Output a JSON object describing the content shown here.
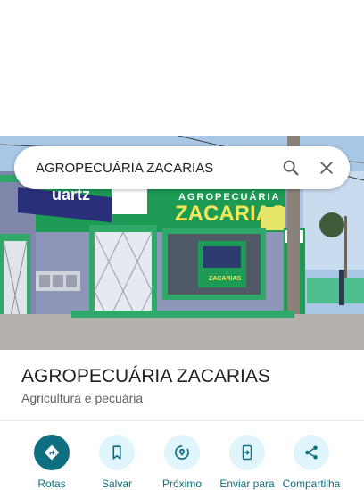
{
  "search": {
    "value": "AGROPECUÁRIA ZACARIAS"
  },
  "place": {
    "name": "AGROPECUÁRIA ZACARIAS",
    "category": "Agricultura e pecuária"
  },
  "photo": {
    "sign_name": "AGROPECUÁRIA",
    "sign_brand": "ZACARIAS",
    "sign_partial": "uartz"
  },
  "actions": [
    {
      "label": "Rotas",
      "icon": "directions-icon"
    },
    {
      "label": "Salvar",
      "icon": "bookmark-icon"
    },
    {
      "label": "Próximo",
      "icon": "nearby-icon"
    },
    {
      "label": "Enviar para",
      "icon": "send-to-phone-icon"
    },
    {
      "label": "Compartilha",
      "icon": "share-icon"
    }
  ],
  "colors": {
    "accent": "#0f6e7f",
    "action_bg": "#e0f5fb",
    "storefront_green": "#2fa86a"
  }
}
